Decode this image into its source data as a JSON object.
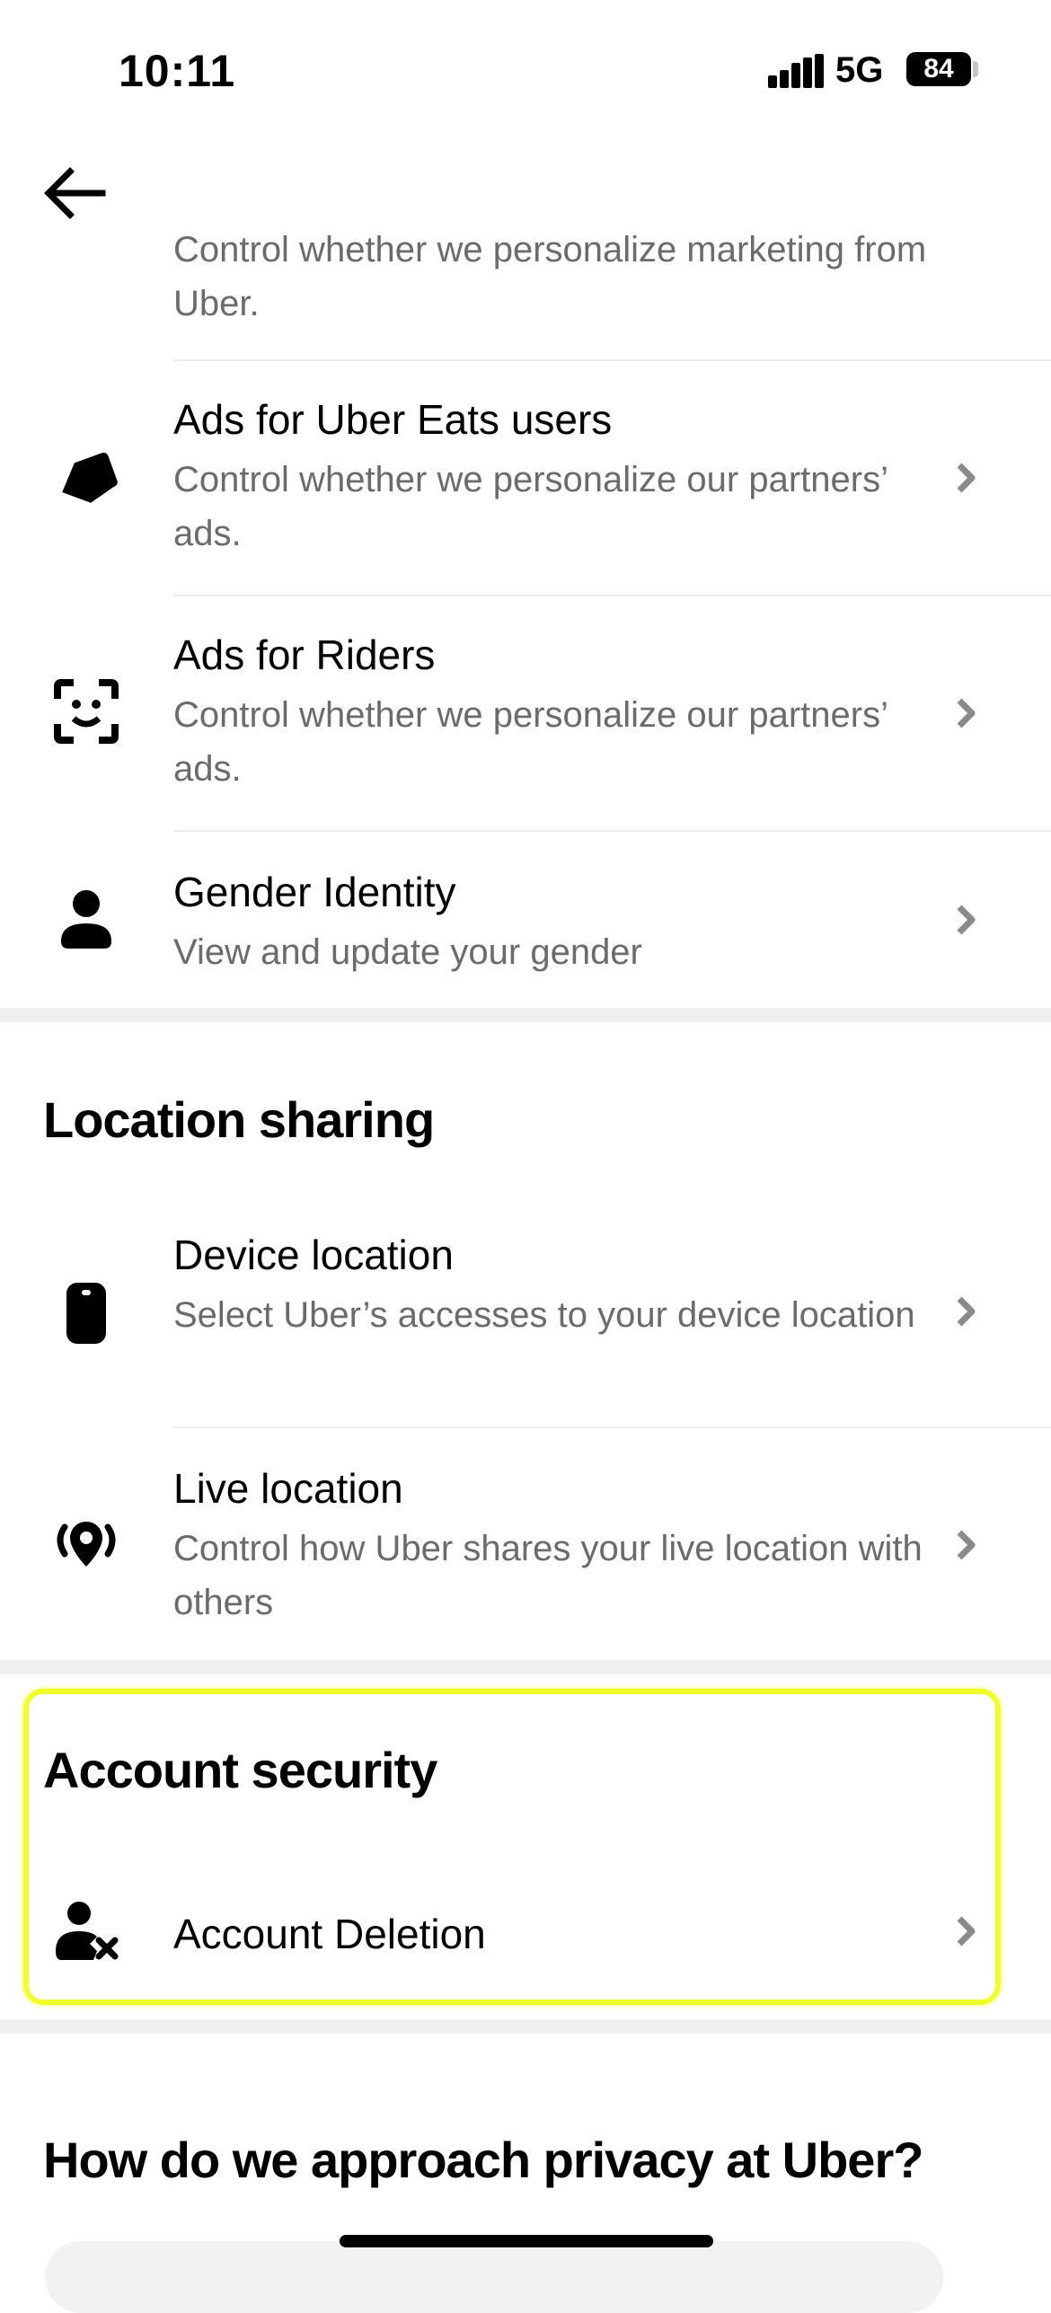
{
  "status_bar": {
    "time": "10:11",
    "network": "5G",
    "battery": "84"
  },
  "nav": {
    "back_icon": "arrow-left-icon"
  },
  "personalization": {
    "partial_item": {
      "subtitle": "Control whether we personalize marketing from Uber."
    },
    "items": [
      {
        "icon": "tag-icon",
        "title": "Ads for Uber Eats users",
        "subtitle": "Control whether we personalize our partners’ ads."
      },
      {
        "icon": "face-scan-icon",
        "title": "Ads for Riders",
        "subtitle": "Control whether we personalize our partners’ ads."
      },
      {
        "icon": "person-icon",
        "title": "Gender Identity",
        "subtitle": "View and update your gender"
      }
    ]
  },
  "location_sharing": {
    "title": "Location sharing",
    "items": [
      {
        "icon": "phone-device-icon",
        "title": "Device location",
        "subtitle": "Select Uber’s accesses to your device location"
      },
      {
        "icon": "live-location-pin-icon",
        "title": "Live location",
        "subtitle": "Control how Uber shares your live location with others"
      }
    ]
  },
  "account_security": {
    "title": "Account security",
    "items": [
      {
        "icon": "person-remove-icon",
        "title": "Account Deletion"
      }
    ]
  },
  "privacy": {
    "title": "How do we approach privacy at Uber?"
  },
  "colors": {
    "highlight": "#f0ff2a",
    "subtitle": "#6b6b6b",
    "divider": "#ececec"
  }
}
